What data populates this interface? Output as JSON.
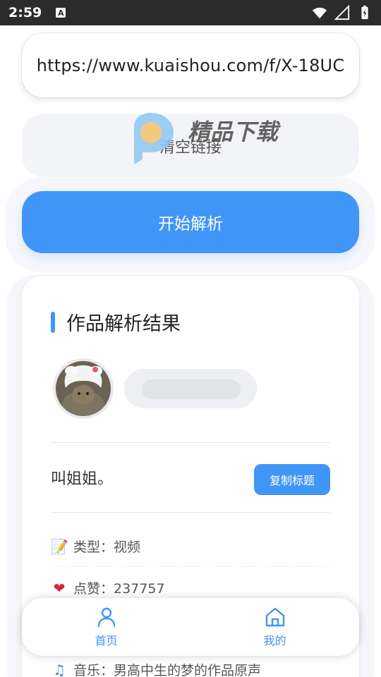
{
  "status_bar": {
    "time": "2:59",
    "a_badge": "A"
  },
  "url_input": {
    "value": "https://www.kuaishou.com/f/X-18UC"
  },
  "clear_button": {
    "label": "清空链接"
  },
  "watermark": {
    "text": "精品下载"
  },
  "parse_button": {
    "label": "开始解析"
  },
  "result_card": {
    "title": "作品解析结果",
    "work_title": "叫姐姐。",
    "copy_title_label": "复制标题",
    "rows": [
      {
        "icon": "memo-icon",
        "text": "类型：视频"
      },
      {
        "icon": "heart-icon",
        "text": "点赞：237757"
      },
      {
        "icon": "music-icon",
        "text": "音乐：男高中生的梦的作品原声"
      }
    ]
  },
  "bottom_nav": {
    "items": [
      {
        "icon": "user-icon",
        "label": "首页"
      },
      {
        "icon": "home-icon",
        "label": "我的"
      }
    ]
  },
  "colors": {
    "accent": "#4096f6",
    "status_bar": "#2b2b2b"
  }
}
